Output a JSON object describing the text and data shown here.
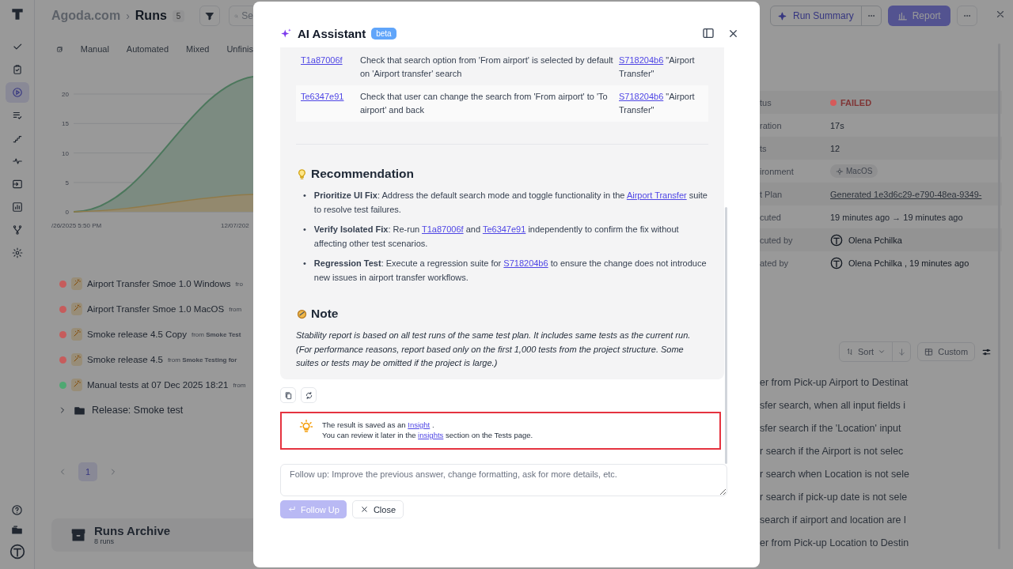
{
  "sidebar": {
    "items": [
      {
        "selected": false
      },
      {
        "selected": false
      },
      {
        "selected": true
      },
      {
        "selected": false
      },
      {
        "selected": false
      },
      {
        "selected": false
      },
      {
        "selected": false
      },
      {
        "selected": false
      },
      {
        "selected": false
      },
      {
        "selected": false
      }
    ]
  },
  "header": {
    "breadcrumb": "Agoda.com",
    "separator": "›",
    "title": "Runs",
    "count": "5",
    "search": {
      "placeholder": "Se"
    }
  },
  "filter_tabs": [
    {
      "label": "Manual"
    },
    {
      "label": "Automated"
    },
    {
      "label": "Mixed"
    },
    {
      "label": "Unfinis"
    }
  ],
  "chart": {
    "yticks": [
      "20",
      "15",
      "10",
      "5",
      "0"
    ],
    "xlabels": [
      "/26/2025 5:50 PM",
      "12/07/202"
    ]
  },
  "runs": [
    {
      "title": "Airport Transfer Smoe 1.0 Windows",
      "source": "fro",
      "color": "#c65c5c"
    },
    {
      "title": "Airport Transfer Smoe 1.0 MacOS",
      "source": "from",
      "color": "#c65c5c"
    },
    {
      "title": "Smoke release 4.5 Copy",
      "source": "from **Smoke Test**",
      "color": "#c65c5c"
    },
    {
      "title": "Smoke release 4.5",
      "source": "from **Smoke Testing for**",
      "color": "#c65c5c"
    },
    {
      "title": "Manual tests at 07 Dec 2025 18:21",
      "source": "from",
      "color": "#4fa872"
    }
  ],
  "folder": {
    "label": "Release: Smoke test",
    "expanded": false
  },
  "pagination": {
    "pages": [
      {
        "label": "1",
        "selected": true
      }
    ]
  },
  "archive": {
    "title": "Runs Archive",
    "count": "8 runs"
  },
  "run_panel": {
    "summary": "Run Summary",
    "report": "Report",
    "details": [
      {
        "label": "tus",
        "value": "FAILED",
        "kind": "status",
        "color": "#d65a5a"
      },
      {
        "label": "ration",
        "value": "17s",
        "kind": "text"
      },
      {
        "label": "ts",
        "value": "12",
        "kind": "text"
      },
      {
        "label": "ironment",
        "value": "MacOS",
        "kind": "tag"
      },
      {
        "label": "t Plan",
        "value": "Generated 1e3d6c29-e790-48ea-9349-",
        "kind": "link"
      },
      {
        "label": "cuted",
        "value": "19 minutes ago → 19 minutes ago",
        "kind": "text"
      },
      {
        "label": "cuted by",
        "value": "Olena Pchilka",
        "kind": "user"
      },
      {
        "label": "ated by",
        "value": "Olena Pchilka , 19 minutes ago",
        "kind": "user"
      }
    ],
    "sort": "Sort",
    "view": "Custom",
    "tests": [
      "er from Pick-up Airport to Destinat",
      "sfer search, when all input fields i",
      "sfer search if the 'Location' input",
      "r search if the Airport is not selec",
      "r search when Location is not sele",
      "r search if pick-up date is not sele",
      "search if airport and location are l",
      "er from Pick-up Location to Destin"
    ]
  },
  "assistant": {
    "title": "AI Assistant",
    "badge": "beta",
    "rows": [
      {
        "id": "T1a87006f",
        "description": "Check that search option from 'From airport' is selected by default on 'Airport transfer' search",
        "suite_id": "S718204b6",
        "suite": "\"Airport Transfer\""
      },
      {
        "id": "Te6347e91",
        "description": "Check that user can change the search from 'From airport' to 'To airport' and back",
        "suite_id": "S718204b6",
        "suite": "\"Airport Transfer\""
      }
    ],
    "recommendation": {
      "title": "Recommendation",
      "items": [
        {
          "marker": "•",
          "parts": [
            {
              "kind": "text",
              "text": "**Prioritize UI Fix**: Address the default search mode and toggle functionality in the "
            },
            {
              "kind": "link",
              "text": "Airport Transfer"
            },
            {
              "kind": "text",
              "text": " suite to resolve test failures."
            }
          ]
        },
        {
          "marker": "•",
          "parts": [
            {
              "kind": "text",
              "text": "**Verify Isolated Fix**: Re-run "
            },
            {
              "kind": "link",
              "text": "T1a87006f"
            },
            {
              "kind": "text",
              "text": " and "
            },
            {
              "kind": "link",
              "text": "Te6347e91"
            },
            {
              "kind": "text",
              "text": " independently to confirm the fix without affecting other test scenarios."
            }
          ]
        },
        {
          "marker": "•",
          "parts": [
            {
              "kind": "text",
              "text": "**Regression Test**: Execute a regression suite for "
            },
            {
              "kind": "link",
              "text": "S718204b6"
            },
            {
              "kind": "text",
              "text": " to ensure the change does not introduce new issues in airport transfer workflows."
            }
          ]
        }
      ]
    },
    "note": {
      "title": "Note",
      "lines": [
        "Stability report is based on all test runs of the same test plan. It includes same tests as the current run.",
        "(For performance reasons, report based only on the first 1,000 tests from the project structure. Some suites or tests may be omitted if the project is large.)"
      ]
    },
    "insight": {
      "lines": [
        [
          {
            "kind": "text",
            "text": "The result is saved as an "
          },
          {
            "kind": "link",
            "text": "Insight"
          },
          {
            "kind": "text",
            "text": " ."
          }
        ],
        [
          {
            "kind": "text",
            "text": "You can review it later in the "
          },
          {
            "kind": "link",
            "text": "insights"
          },
          {
            "kind": "text",
            "text": " section on the Tests page."
          }
        ]
      ]
    },
    "follow_up": {
      "placeholder": "Follow up: Improve the previous answer, change formatting, ask for more details, etc.",
      "submit": "Follow Up",
      "close": "Close"
    }
  }
}
